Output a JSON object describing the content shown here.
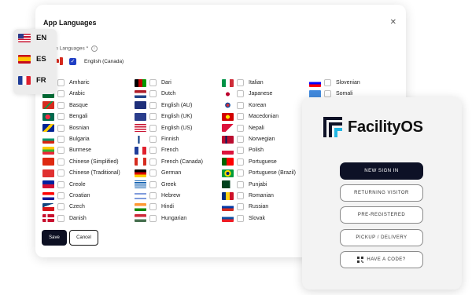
{
  "dialog": {
    "title": "App Languages",
    "close_icon": "close-icon",
    "apps_label": "ication Languages *",
    "selected_language": "English (Canada)",
    "save_label": "Save",
    "cancel_label": "Cancel",
    "languages": [
      [
        "Amharic",
        "Dari",
        "Italian",
        "Slovenian"
      ],
      [
        "Arabic",
        "Dutch",
        "Japanese",
        "Somali"
      ],
      [
        "Basque",
        "English (AU)",
        "Korean",
        ""
      ],
      [
        "Bengali",
        "English (UK)",
        "Macedonian",
        ""
      ],
      [
        "Bosnian",
        "English (US)",
        "Nepali",
        ""
      ],
      [
        "Bulgaria",
        "Finnish",
        "Norwegian",
        ""
      ],
      [
        "Burmese",
        "French",
        "Polish",
        ""
      ],
      [
        "Chinese (Simplified)",
        "French (Canada)",
        "Portuguese",
        ""
      ],
      [
        "Chinese (Traditional)",
        "German",
        "Portuguese (Brazil)",
        ""
      ],
      [
        "Creole",
        "Greek",
        "Punjabi",
        ""
      ],
      [
        "Croatian",
        "Hebrew",
        "Romanian",
        ""
      ],
      [
        "Czech",
        "Hindi",
        "Russian",
        ""
      ],
      [
        "Danish",
        "Hungarian",
        "Slovak",
        ""
      ]
    ]
  },
  "switcher": {
    "items": [
      {
        "code": "EN",
        "flag": "us-flag-icon"
      },
      {
        "code": "ES",
        "flag": "es-flag-icon"
      },
      {
        "code": "FR",
        "flag": "fr-flag-icon"
      }
    ]
  },
  "kiosk": {
    "brand": "FacilityOS",
    "buttons": [
      "NEW SIGN IN",
      "RETURNING VISITOR",
      "PRE-REGISTERED",
      "PICKUP / DELIVERY",
      "HAVE A CODE?"
    ]
  },
  "colors": {
    "primary_dark": "#0d1126",
    "checkbox_blue": "#1f3ec4",
    "brand_cyan": "#21b6e3"
  }
}
